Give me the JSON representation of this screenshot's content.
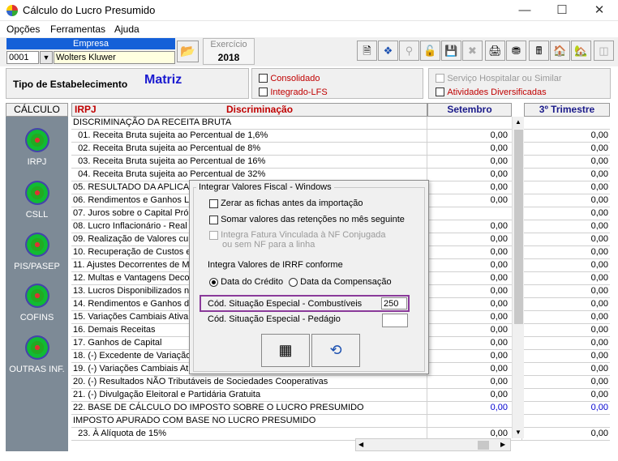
{
  "window": {
    "title": "Cálculo do Lucro Presumido"
  },
  "menu": [
    "Opções",
    "Ferramentas",
    "Ajuda"
  ],
  "empresa": {
    "label": "Empresa",
    "code": "0001",
    "name": "Wolters Kluwer"
  },
  "exercicio": {
    "label": "Exercício",
    "value": "2018"
  },
  "tipo": {
    "label": "Tipo de Estabelecimento",
    "value": "Matriz"
  },
  "options": {
    "consolidado": "Consolidado",
    "integrado": "Integrado-LFS",
    "servico": "Serviço Hospitalar ou Similar",
    "atividades": "Atividades Diversificadas"
  },
  "sidebar": {
    "header": "CÁLCULO",
    "items": [
      "IRPJ",
      "CSLL",
      "PIS/PASEP",
      "COFINS",
      "OUTRAS INF."
    ]
  },
  "grid": {
    "headers": {
      "tax": "IRPJ",
      "desc": "Discriminação",
      "col1": "Setembro",
      "col2": "3º Trimestre"
    },
    "rows": [
      {
        "d": "DISCRIMINAÇÃO DA RECEITA BRUTA",
        "v1": "",
        "v2": ""
      },
      {
        "d": "  01. Receita Bruta sujeita ao Percentual de 1,6%",
        "v1": "0,00",
        "v2": "0,00"
      },
      {
        "d": "  02. Receita Bruta sujeita ao Percentual de 8%",
        "v1": "0,00",
        "v2": "0,00"
      },
      {
        "d": "  03. Receita Bruta sujeita ao Percentual de 16%",
        "v1": "0,00",
        "v2": "0,00"
      },
      {
        "d": "  04. Receita Bruta sujeita ao Percentual de 32%",
        "v1": "0,00",
        "v2": "0,00"
      },
      {
        "d": "05. RESULTADO DA APLICAÇ",
        "v1": "0,00",
        "v2": "0,00"
      },
      {
        "d": "06. Rendimentos e Ganhos Li",
        "v1": "0,00",
        "v2": "0,00"
      },
      {
        "d": "07. Juros sobre o Capital Pró",
        "v1": "",
        "v2": "0,00"
      },
      {
        "d": "08. Lucro Inflacionário - Real",
        "v1": "0,00",
        "v2": "0,00"
      },
      {
        "d": "09. Realização de Valores cu",
        "v1": "0,00",
        "v2": "0,00"
      },
      {
        "d": "10. Recuperação de Custos e",
        "v1": "0,00",
        "v2": "0,00"
      },
      {
        "d": "11. Ajustes Decorrentes de M",
        "v1": "0,00",
        "v2": "0,00"
      },
      {
        "d": "12. Multas e Vantagens Deco",
        "v1": "0,00",
        "v2": "0,00"
      },
      {
        "d": "13. Lucros Disponibilizados no",
        "v1": "0,00",
        "v2": "0,00"
      },
      {
        "d": "14. Rendimentos e Ganhos d",
        "v1": "0,00",
        "v2": "0,00"
      },
      {
        "d": "15. Variações Cambiais Ativa",
        "v1": "0,00",
        "v2": "0,00"
      },
      {
        "d": "16. Demais Receitas",
        "v1": "0,00",
        "v2": "0,00"
      },
      {
        "d": "17. Ganhos de Capital",
        "v1": "0,00",
        "v2": "0,00"
      },
      {
        "d": "18. (-) Excedente de Variação",
        "v1": "0,00",
        "v2": "0,00"
      },
      {
        "d": "19. (-) Variações Cambiais At",
        "v1": "0,00",
        "v2": "0,00"
      },
      {
        "d": "20. (-) Resultados NÃO Tributáveis de Sociedades Cooperativas",
        "v1": "0,00",
        "v2": "0,00"
      },
      {
        "d": "21. (-) Divulgação Eleitoral e Partidária Gratuita",
        "v1": "0,00",
        "v2": "0,00"
      },
      {
        "d": "22. BASE DE CÁLCULO DO IMPOSTO SOBRE O LUCRO PRESUMIDO",
        "v1": "0,00",
        "v2": "0,00",
        "blue": true
      },
      {
        "d": "IMPOSTO APURADO COM BASE NO LUCRO PRESUMIDO",
        "v1": "",
        "v2": ""
      },
      {
        "d": "  23. À Alíquota de 15%",
        "v1": "0,00",
        "v2": "0,00"
      }
    ]
  },
  "dialog": {
    "title": "Integrar Valores Fiscal - Windows",
    "zerar": "Zerar as fichas antes da importação",
    "somar": "Somar valores das retenções no mês seguinte",
    "integra_line1": "Integra Fatura Vinculada à NF Conjugada",
    "integra_line2": "ou sem NF para a linha",
    "irrf_label": "Integra Valores de IRRF conforme",
    "radio1": "Data do Crédito",
    "radio2": "Data da Compensação",
    "comb_label": "Cód. Situação Especial - Combustíveis",
    "comb_value": "250",
    "ped_label": "Cód. Situação Especial - Pedágio",
    "ped_value": ""
  }
}
